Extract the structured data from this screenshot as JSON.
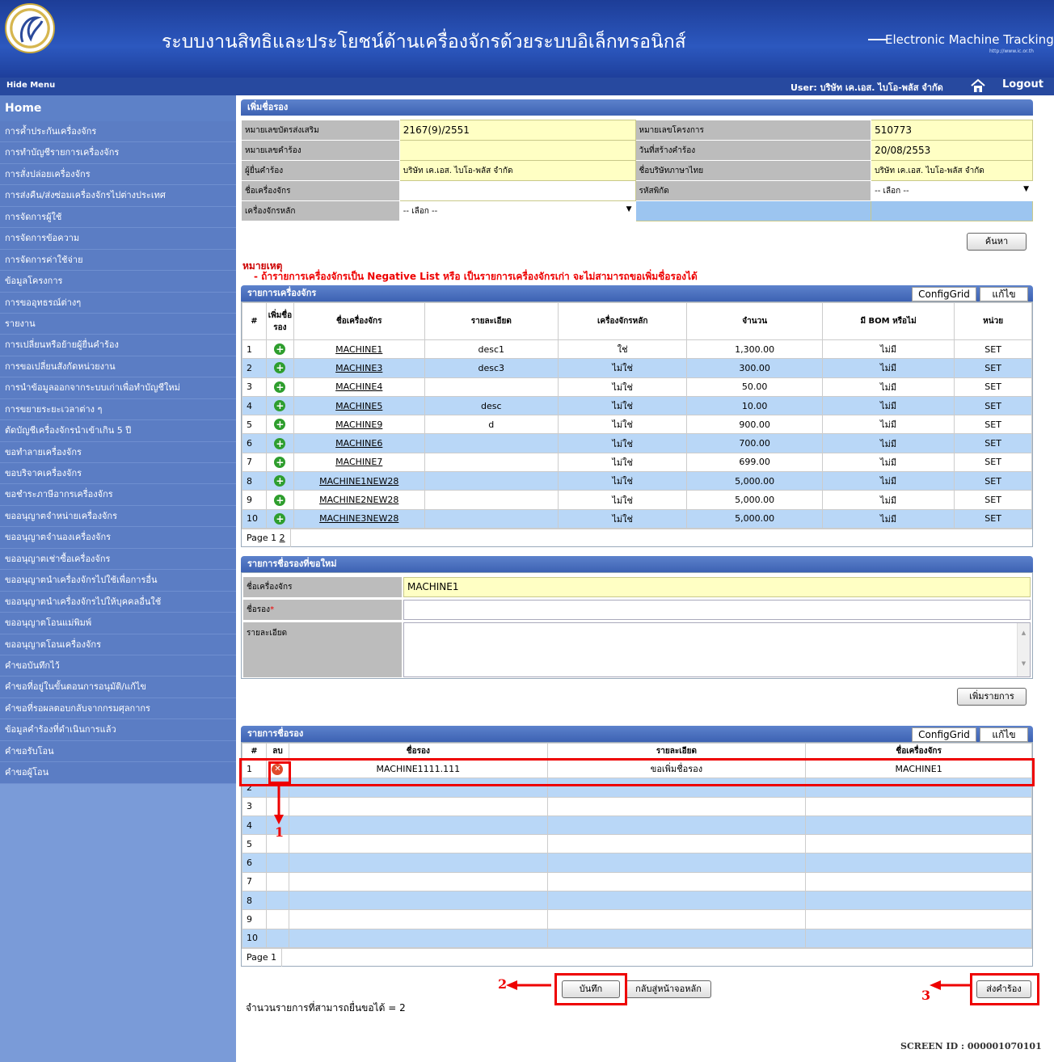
{
  "header": {
    "title": "ระบบงานสิทธิและประโยชน์ด้านเครื่องจักรด้วยระบบอิเล็กทรอนิกส์",
    "brand": "Electronic Machine Tracking",
    "url": "http://www.ic.or.th",
    "hide_menu": "Hide Menu",
    "user": "User: บริษัท เค.เอส. ไบโอ-พลัส จำกัด",
    "logout": "Logout"
  },
  "sidebar": {
    "home": "Home",
    "items": [
      "การค้ำประกันเครื่องจักร",
      "การทำบัญชีรายการเครื่องจักร",
      "การสั่งปล่อยเครื่องจักร",
      "การส่งคืน/ส่งซ่อมเครื่องจักรไปต่างประเทศ",
      "การจัดการผู้ใช้",
      "การจัดการข้อความ",
      "การจัดการค่าใช้จ่าย",
      "ข้อมูลโครงการ",
      "การขออุทธรณ์ต่างๆ",
      "รายงาน",
      "การเปลี่ยนหรือย้ายผู้ยื่นคำร้อง",
      "การขอเปลี่ยนสังกัดหน่วยงาน",
      "การนำข้อมูลออกจากระบบเก่าเพื่อทำบัญชีใหม่",
      "การขยายระยะเวลาต่าง ๆ",
      "ตัดบัญชีเครื่องจักรนำเข้าเกิน 5 ปี",
      "ขอทำลายเครื่องจักร",
      "ขอบริจาคเครื่องจักร",
      "ขอชำระภาษีอากรเครื่องจักร",
      "ขออนุญาตจำหน่ายเครื่องจักร",
      "ขออนุญาตจำนองเครื่องจักร",
      "ขออนุญาตเช่าซื้อเครื่องจักร",
      "ขออนุญาตนำเครื่องจักรไปใช้เพื่อการอื่น",
      "ขออนุญาตนำเครื่องจักรไปให้บุคคลอื่นใช้",
      "ขออนุญาตโอนแม่พิมพ์",
      "ขออนุญาตโอนเครื่องจักร",
      "คำขอบันทึกไว้",
      "คำขอที่อยู่ในขั้นตอนการอนุมัติ/แก้ไข",
      "คำขอที่รอผลตอบกลับจากกรมศุลกากร",
      "ข้อมูลคำร้องที่ดำเนินการแล้ว",
      "คำขอรับโอน",
      "คำขอผู้โอน"
    ]
  },
  "search": {
    "panel_title": "เพิ่มชื่อรอง",
    "promo_label": "หมายเลขบัตรส่งเสริม",
    "promo_value": "2167(9)/2551",
    "project_label": "หมายเลขโครงการ",
    "project_value": "510773",
    "req_no_label": "หมายเลขคำร้อง",
    "req_no_value": "",
    "req_date_label": "วันที่สร้างคำร้อง",
    "req_date_value": "20/08/2553",
    "applicant_label": "ผู้ยื่นคำร้อง",
    "applicant_value": "บริษัท เค.เอส. ไบโอ-พลัส จำกัด",
    "thai_name_label": "ชื่อบริษัทภาษาไทย",
    "thai_name_value": "บริษัท เค.เอส. ไบโอ-พลัส จำกัด",
    "machine_label": "ชื่อเครื่องจักร",
    "machine_value": "",
    "tariff_label": "รหัสพิกัด",
    "tariff_value": "-- เลือก --",
    "main_label": "เครื่องจักรหลัก",
    "main_value": "-- เลือก --",
    "search_button": "ค้นหา"
  },
  "note": {
    "head": "หมายเหตุ",
    "text": "- ถ้ารายการเครื่องจักรเป็น Negative List หรือ เป็นรายการเครื่องจักรเก่า จะไม่สามารถขอเพิ่มชื่อรองได้"
  },
  "machines": {
    "title": "รายการเครื่องจักร",
    "config": "ConfigGrid",
    "edit": "แก้ไข",
    "headers": [
      "#",
      "เพิ่มชื่อรอง",
      "ชื่อเครื่องจักร",
      "รายละเอียด",
      "เครื่องจักรหลัก",
      "จำนวน",
      "มี BOM หรือไม่",
      "หน่วย"
    ],
    "rows": [
      {
        "n": "1",
        "name": "MACHINE1",
        "desc": "desc1",
        "main": "ใช่",
        "qty": "1,300.00",
        "bom": "ไม่มี",
        "unit": "SET"
      },
      {
        "n": "2",
        "name": "MACHINE3",
        "desc": "desc3",
        "main": "ไม่ใช่",
        "qty": "300.00",
        "bom": "ไม่มี",
        "unit": "SET"
      },
      {
        "n": "3",
        "name": "MACHINE4",
        "desc": "",
        "main": "ไม่ใช่",
        "qty": "50.00",
        "bom": "ไม่มี",
        "unit": "SET"
      },
      {
        "n": "4",
        "name": "MACHINE5",
        "desc": "desc",
        "main": "ไม่ใช่",
        "qty": "10.00",
        "bom": "ไม่มี",
        "unit": "SET"
      },
      {
        "n": "5",
        "name": "MACHINE9",
        "desc": "d",
        "main": "ไม่ใช่",
        "qty": "900.00",
        "bom": "ไม่มี",
        "unit": "SET"
      },
      {
        "n": "6",
        "name": "MACHINE6",
        "desc": "",
        "main": "ไม่ใช่",
        "qty": "700.00",
        "bom": "ไม่มี",
        "unit": "SET"
      },
      {
        "n": "7",
        "name": "MACHINE7",
        "desc": "",
        "main": "ไม่ใช่",
        "qty": "699.00",
        "bom": "ไม่มี",
        "unit": "SET"
      },
      {
        "n": "8",
        "name": "MACHINE1NEW28",
        "desc": "",
        "main": "ไม่ใช่",
        "qty": "5,000.00",
        "bom": "ไม่มี",
        "unit": "SET"
      },
      {
        "n": "9",
        "name": "MACHINE2NEW28",
        "desc": "",
        "main": "ไม่ใช่",
        "qty": "5,000.00",
        "bom": "ไม่มี",
        "unit": "SET"
      },
      {
        "n": "10",
        "name": "MACHINE3NEW28",
        "desc": "",
        "main": "ไม่ใช่",
        "qty": "5,000.00",
        "bom": "ไม่มี",
        "unit": "SET"
      }
    ],
    "page_label": "Page 1",
    "page_next": "2"
  },
  "new_alias": {
    "title": "รายการชื่อรองที่ขอใหม่",
    "machine_label": "ชื่อเครื่องจักร",
    "machine_value": "MACHINE1",
    "alias_label": "ชื่อรอง",
    "required_mark": "*",
    "alias_value": "",
    "detail_label": "รายละเอียด",
    "detail_value": "",
    "add_button": "เพิ่มรายการ"
  },
  "aliases": {
    "title": "รายการชื่อรอง",
    "config": "ConfigGrid",
    "edit": "แก้ไข",
    "headers": [
      "#",
      "ลบ",
      "ชื่อรอง",
      "รายละเอียด",
      "ชื่อเครื่องจักร"
    ],
    "rows": [
      {
        "n": "1",
        "alias": "MACHINE1111.111",
        "detail": "ขอเพิ่มชื่อรอง",
        "machine": "MACHINE1"
      },
      {
        "n": "2",
        "alias": "",
        "detail": "",
        "machine": ""
      },
      {
        "n": "3",
        "alias": "",
        "detail": "",
        "machine": ""
      },
      {
        "n": "4",
        "alias": "",
        "detail": "",
        "machine": ""
      },
      {
        "n": "5",
        "alias": "",
        "detail": "",
        "machine": ""
      },
      {
        "n": "6",
        "alias": "",
        "detail": "",
        "machine": ""
      },
      {
        "n": "7",
        "alias": "",
        "detail": "",
        "machine": ""
      },
      {
        "n": "8",
        "alias": "",
        "detail": "",
        "machine": ""
      },
      {
        "n": "9",
        "alias": "",
        "detail": "",
        "machine": ""
      },
      {
        "n": "10",
        "alias": "",
        "detail": "",
        "machine": ""
      }
    ],
    "page_label": "Page 1"
  },
  "footer": {
    "count_text": "จำนวนรายการที่สามารถยื่นขอได้ = 2",
    "save_button": "บันทึก",
    "back_button": "กลับสู่หน้าจอหลัก",
    "submit_button": "ส่งคำร้อง",
    "screen_id": "SCREEN ID :  000001070101"
  },
  "annotations": {
    "one": "1",
    "two": "2",
    "three": "3"
  },
  "colors": {
    "accent": "#e00000",
    "grid_alt": "#b9d7f7",
    "input_yellow": "#ffffc4"
  }
}
